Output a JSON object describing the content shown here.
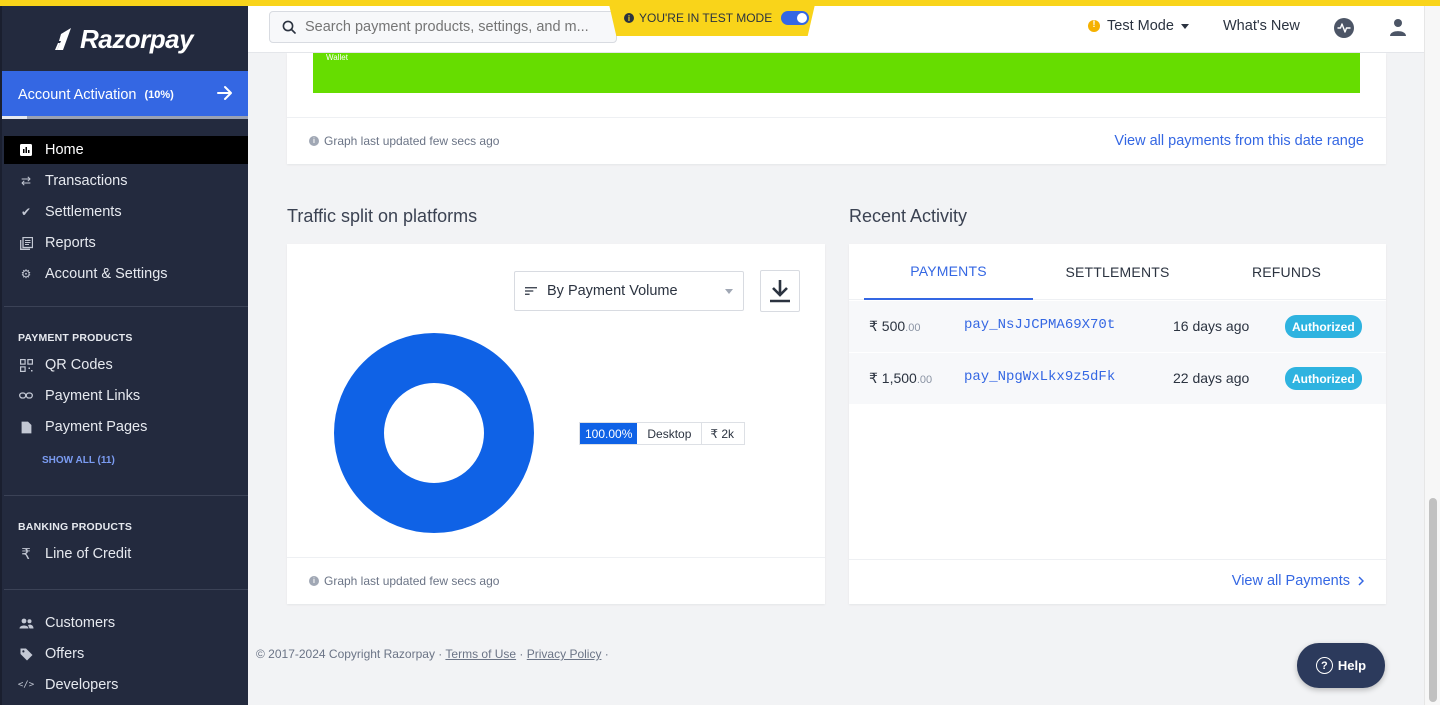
{
  "brand": {
    "name": "Razorpay"
  },
  "sidebar": {
    "activation": {
      "label": "Account Activation",
      "percent": "(10%)",
      "progress": 0.1
    },
    "main_nav": [
      {
        "label": "Home",
        "icon": "chart-icon",
        "active": true
      },
      {
        "label": "Transactions",
        "icon": "transfer-icon"
      },
      {
        "label": "Settlements",
        "icon": "check-icon"
      },
      {
        "label": "Reports",
        "icon": "reports-icon"
      },
      {
        "label": "Account & Settings",
        "icon": "gear-icon"
      }
    ],
    "payment_products_title": "PAYMENT PRODUCTS",
    "payment_products": [
      {
        "label": "QR Codes",
        "icon": "qr-icon"
      },
      {
        "label": "Payment Links",
        "icon": "link-icon"
      },
      {
        "label": "Payment Pages",
        "icon": "page-icon"
      }
    ],
    "show_all": "SHOW ALL (11)",
    "banking_products_title": "BANKING PRODUCTS",
    "banking_products": [
      {
        "label": "Line of Credit",
        "icon": "rupee-icon"
      }
    ],
    "bottom_nav": [
      {
        "label": "Customers",
        "icon": "users-icon"
      },
      {
        "label": "Offers",
        "icon": "tag-icon"
      },
      {
        "label": "Developers",
        "icon": "code-icon"
      }
    ]
  },
  "header": {
    "search_placeholder": "Search payment products, settings, and m...",
    "test_banner": "YOU'RE IN TEST MODE",
    "mode_label": "Test Mode",
    "whats_new": "What's New"
  },
  "payments_card": {
    "bar_label": "Wallet",
    "graph_note": "Graph last updated few secs ago",
    "view_range": "View all payments from this date range",
    "accent": "#66dd00"
  },
  "traffic": {
    "title": "Traffic split on platforms",
    "dropdown_value": "By Payment Volume",
    "legend": {
      "percent": "100.00%",
      "name": "Desktop",
      "amount": "₹ 2k"
    },
    "graph_note": "Graph last updated few secs ago",
    "accent": "#0f62e6"
  },
  "recent": {
    "title": "Recent Activity",
    "tabs": [
      "PAYMENTS",
      "SETTLEMENTS",
      "REFUNDS"
    ],
    "rows": [
      {
        "amount_symbol": "₹ ",
        "amount_main": "500",
        "amount_paise": ".00",
        "id": "pay_NsJJCPMA69X70t",
        "ago": "16 days ago",
        "status": "Authorized"
      },
      {
        "amount_symbol": "₹ ",
        "amount_main": "1,500",
        "amount_paise": ".00",
        "id": "pay_NpgWxLkx9z5dFk",
        "ago": "22 days ago",
        "status": "Authorized"
      }
    ],
    "view_all": "View all Payments"
  },
  "footer": {
    "copyright": "© 2017-2024 Copyright Razorpay · ",
    "terms": "Terms of Use",
    "sep": " · ",
    "privacy": "Privacy Policy",
    "trail": " ·"
  },
  "help": {
    "label": "Help",
    "icon": "question-icon"
  }
}
